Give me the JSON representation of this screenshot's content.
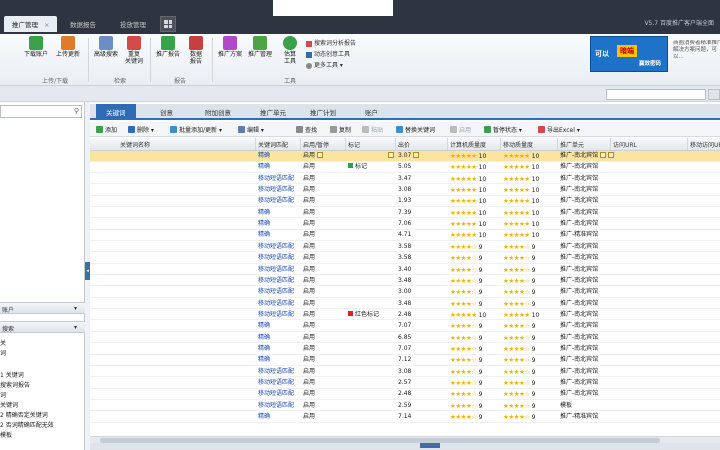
{
  "window": {
    "tabs": [
      {
        "label": "推广管理",
        "close": "×"
      },
      {
        "label": "数据报告"
      },
      {
        "label": "投放管理"
      }
    ],
    "version": "V5.7 百度推广客户端全面"
  },
  "ribbon": {
    "btn_download": "下载账户",
    "btn_upload": "上传更新",
    "btn_search": "高级搜索",
    "btn_recheck": "重复\n关键词",
    "btn_report": "推广报告",
    "btn_data": "数据\n报告",
    "btn_tool1": "推广方案",
    "btn_tool2": "推广管理",
    "btn_tool3": "估算\n工具",
    "small1": "搜索词分析报告",
    "small2": "动态创意工具",
    "small3": "更多工具",
    "group1": "上传/下载",
    "group2": "检索",
    "group3": "报告",
    "group4": "工具",
    "ad_left": "可以",
    "ad_mid": "暗端",
    "ad_right": "赢效密码",
    "ad_text": "商圈消费者精准推广解决方案问题，可以..."
  },
  "left_panel": {
    "header1": "账户",
    "header2": "搜索",
    "items": [
      "关",
      "词",
      "1 关键词",
      "搜索词报告",
      "词",
      "关键词",
      "2 精确否定关键词",
      "2 否词精确匹配无效",
      "模板"
    ]
  },
  "main_tabs": [
    "关键词",
    "创意",
    "附加创意",
    "推广单元",
    "推广计划",
    "账户"
  ],
  "toolbar": {
    "add": "添加",
    "del": "删除",
    "move": "批量添加/更新",
    "edit": "编辑",
    "search": "查找",
    "copy": "复制",
    "paste": "粘贴",
    "replace": "替换关键词",
    "stop": "启用",
    "pause": "暂停状态",
    "export": "导出Excel"
  },
  "table": {
    "headers": [
      "关键词名称",
      "关键词匹配",
      "启用/暂停",
      "标记",
      "出价",
      "计算机质量度",
      "移动质量度",
      "推广单元",
      "访问URL",
      "移动访问URL"
    ],
    "rows": [
      {
        "match": "精确",
        "status": "启用",
        "mark": "",
        "price": "3.07",
        "q1": "10",
        "q2": "10",
        "plan": "推广-南北宾馆"
      },
      {
        "match": "精确",
        "status": "启用",
        "mark": "标记",
        "price": "5.05",
        "q1": "10",
        "q2": "10",
        "plan": "推广-南北宾馆"
      },
      {
        "match": "移动短语匹配",
        "status": "启用",
        "mark": "",
        "price": "3.47",
        "q1": "10",
        "q2": "10",
        "plan": "推广-南北宾馆"
      },
      {
        "match": "移动短语匹配",
        "status": "启用",
        "mark": "",
        "price": "3.08",
        "q1": "10",
        "q2": "10",
        "plan": "推广-南北宾馆"
      },
      {
        "match": "移动短语匹配",
        "status": "启用",
        "mark": "",
        "price": "1.93",
        "q1": "10",
        "q2": "10",
        "plan": "推广-南北宾馆"
      },
      {
        "match": "精确",
        "status": "启用",
        "mark": "",
        "price": "7.39",
        "q1": "10",
        "q2": "10",
        "plan": "推广-南北宾馆"
      },
      {
        "match": "精确",
        "status": "启用",
        "mark": "",
        "price": "7.06",
        "q1": "10",
        "q2": "10",
        "plan": "推广-南北宾馆"
      },
      {
        "match": "精确",
        "status": "启用",
        "mark": "",
        "price": "4.71",
        "q1": "10",
        "q2": "10",
        "plan": "推广-精准宾馆"
      },
      {
        "match": "移动短语匹配",
        "status": "启用",
        "mark": "",
        "price": "3.58",
        "q1": "9",
        "q2": "9",
        "plan": "推广-南北宾馆"
      },
      {
        "match": "移动短语匹配",
        "status": "启用",
        "mark": "",
        "price": "3.58",
        "q1": "9",
        "q2": "9",
        "plan": "推广-南北宾馆"
      },
      {
        "match": "移动短语匹配",
        "status": "启用",
        "mark": "",
        "price": "3.40",
        "q1": "9",
        "q2": "9",
        "plan": "推广-南北宾馆"
      },
      {
        "match": "移动短语匹配",
        "status": "启用",
        "mark": "",
        "price": "3.48",
        "q1": "9",
        "q2": "9",
        "plan": "推广-南北宾馆"
      },
      {
        "match": "移动短语匹配",
        "status": "启用",
        "mark": "",
        "price": "3.00",
        "q1": "9",
        "q2": "9",
        "plan": "推广-南北宾馆"
      },
      {
        "match": "移动短语匹配",
        "status": "启用",
        "mark": "",
        "price": "3.48",
        "q1": "9",
        "q2": "9",
        "plan": "推广-南北宾馆"
      },
      {
        "match": "移动短语匹配",
        "status": "启用",
        "mark": "红色标记",
        "price": "2.48",
        "q1": "10",
        "q2": "10",
        "plan": "推广-南北宾馆"
      },
      {
        "match": "精确",
        "status": "启用",
        "mark": "",
        "price": "7.07",
        "q1": "9",
        "q2": "9",
        "plan": "推广-南北宾馆"
      },
      {
        "match": "精确",
        "status": "启用",
        "mark": "",
        "price": "6.85",
        "q1": "9",
        "q2": "9",
        "plan": "推广-南北宾馆"
      },
      {
        "match": "精确",
        "status": "启用",
        "mark": "",
        "price": "7.07",
        "q1": "9",
        "q2": "9",
        "plan": "推广-南北宾馆"
      },
      {
        "match": "精确",
        "status": "启用",
        "mark": "",
        "price": "7.12",
        "q1": "9",
        "q2": "9",
        "plan": "推广-南北宾馆"
      },
      {
        "match": "移动短语匹配",
        "status": "启用",
        "mark": "",
        "price": "3.08",
        "q1": "9",
        "q2": "9",
        "plan": "推广-南北宾馆"
      },
      {
        "match": "移动短语匹配",
        "status": "启用",
        "mark": "",
        "price": "2.57",
        "q1": "9",
        "q2": "9",
        "plan": "推广-南北宾馆"
      },
      {
        "match": "移动短语匹配",
        "status": "启用",
        "mark": "",
        "price": "2.48",
        "q1": "9",
        "q2": "9",
        "plan": "推广-南北宾馆"
      },
      {
        "match": "移动短语匹配",
        "status": "启用",
        "mark": "",
        "price": "2.59",
        "q1": "9",
        "q2": "9",
        "plan": "模板"
      },
      {
        "match": "精确",
        "status": "启用",
        "mark": "",
        "price": "7.14",
        "q1": "9",
        "q2": "9",
        "plan": "推广-精准宾馆"
      }
    ]
  },
  "colors": {
    "accent": "#2f6cb5",
    "selected_row": "#fbe3a0",
    "star": "#f0b400",
    "link": "#1a47b8",
    "titlebar": "#2e3440"
  }
}
